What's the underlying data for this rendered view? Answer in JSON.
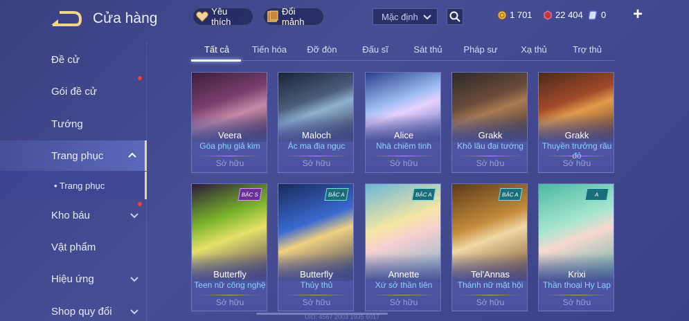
{
  "header": {
    "title": "Cửa hàng",
    "favorites_label": "Yêu thích",
    "exchange_label": "Đổi mảnh",
    "sort_value": "Mặc định",
    "currencies": [
      {
        "icon": "gold-coin-icon",
        "value": "1 701"
      },
      {
        "icon": "red-gem-icon",
        "value": "22 404"
      },
      {
        "icon": "voucher-icon",
        "value": "0"
      }
    ],
    "plus_label": "+"
  },
  "sidebar": {
    "items": [
      {
        "label": "Đề cử"
      },
      {
        "label": "Gói đề cử"
      },
      {
        "label": "Tướng"
      },
      {
        "label": "Trang phục"
      },
      {
        "label": "• Trang phục"
      },
      {
        "label": "Kho báu"
      },
      {
        "label": "Vật phẩm"
      },
      {
        "label": "Hiệu ứng"
      },
      {
        "label": "Shop quy đổi"
      }
    ]
  },
  "tabs": [
    "Tất cả",
    "Tiến hóa",
    "Đỡ đòn",
    "Đấu sĩ",
    "Sát thủ",
    "Pháp sư",
    "Xạ thủ",
    "Trợ thủ"
  ],
  "cards": [
    {
      "hero": "Veera",
      "skin": "Góa phụ giả kim",
      "status": "Sở hữu",
      "tier": ""
    },
    {
      "hero": "Maloch",
      "skin": "Ác ma địa ngục",
      "status": "Sở hữu",
      "tier": ""
    },
    {
      "hero": "Alice",
      "skin": "Nhà chiêm tinh",
      "status": "Sở hữu",
      "tier": ""
    },
    {
      "hero": "Grakk",
      "skin": "Khô lâu đại tướng",
      "status": "Sở hữu",
      "tier": ""
    },
    {
      "hero": "Grakk",
      "skin": "Thuyền trưởng râu đỏ",
      "status": "Sở hữu",
      "tier": ""
    },
    {
      "hero": "Butterfly",
      "skin": "Teen nữ công nghệ",
      "status": "Sở hữu",
      "tier": "BẬC S"
    },
    {
      "hero": "Butterfly",
      "skin": "Thủy thủ",
      "status": "Sở hữu",
      "tier": "BẬC A"
    },
    {
      "hero": "Annette",
      "skin": "Xứ sở thần tiên",
      "status": "Sở hữu",
      "tier": "BẬC A"
    },
    {
      "hero": "Tel'Annas",
      "skin": "Thánh nữ mặt hội",
      "status": "Sở hữu",
      "tier": "BẬC A"
    },
    {
      "hero": "Krixi",
      "skin": "Thần thoại Hy Lạp",
      "status": "Sở hữu",
      "tier": "A"
    }
  ],
  "footer": {
    "watermark": "UID: 4567 2003 1935 6017"
  },
  "colors": {
    "accent": "#f0d58a",
    "skin_text": "#8fd0ff",
    "background": "#434a90"
  }
}
